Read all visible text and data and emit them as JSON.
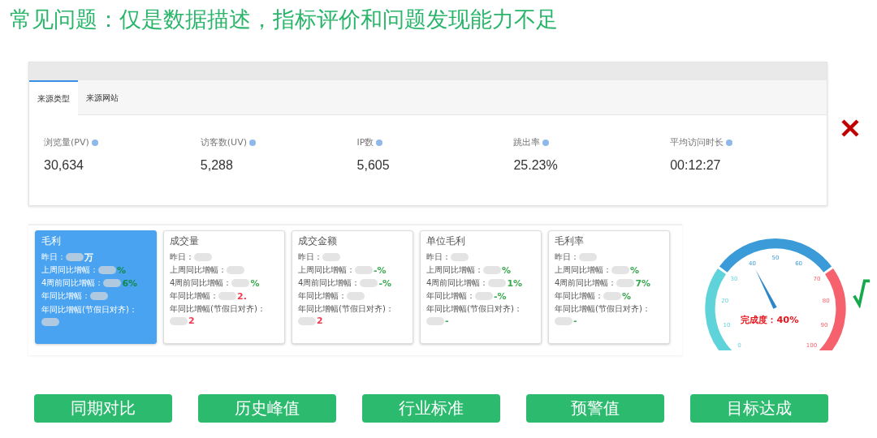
{
  "title": "常见问题：仅是数据描述，指标评价和问题发现能力不足",
  "traffic_panel": {
    "tabs": [
      {
        "label": "来源类型",
        "selected": true
      },
      {
        "label": "来源网站",
        "selected": false
      }
    ],
    "metrics": [
      {
        "label": "浏览量(PV)",
        "value": "30,634"
      },
      {
        "label": "访客数(UV)",
        "value": "5,288"
      },
      {
        "label": "IP数",
        "value": "5,605"
      },
      {
        "label": "跳出率",
        "value": "25.23%"
      },
      {
        "label": "平均访问时长",
        "value": "00:12:27"
      }
    ]
  },
  "kpi_panel": {
    "cards": [
      {
        "title": "毛利",
        "selected": true,
        "rows": [
          {
            "label": "昨日：",
            "value": "万",
            "color": "#ffffff"
          },
          {
            "label": "上周同比增幅：",
            "value": "%",
            "color": "#0f8a4a"
          },
          {
            "label": "4周前同比增幅：",
            "value": "6%",
            "color": "#0f8a4a"
          },
          {
            "label": "年同比增幅："
          },
          {
            "label": "年同比增幅(节假日对齐)："
          }
        ]
      },
      {
        "title": "成交量",
        "selected": false,
        "rows": [
          {
            "label": "昨日："
          },
          {
            "label": "上周同比增幅："
          },
          {
            "label": "4周前同比增幅：",
            "value": "%",
            "color": "#3aaa50"
          },
          {
            "label": "年同比增幅：",
            "value": "2.",
            "color": "#f03a50"
          },
          {
            "label": "年同比增幅(节假日对齐)：",
            "value": "2",
            "color": "#f03a50"
          }
        ]
      },
      {
        "title": "成交金额",
        "selected": false,
        "rows": [
          {
            "label": "昨日："
          },
          {
            "label": "上周同比增幅：",
            "value": "-%",
            "color": "#3aaa50"
          },
          {
            "label": "4周前同比增幅：",
            "value": "-%",
            "color": "#3aaa50"
          },
          {
            "label": "年同比增幅："
          },
          {
            "label": "年同比增幅(节假日对齐)：",
            "value": "2",
            "color": "#f03a50"
          }
        ]
      },
      {
        "title": "单位毛利",
        "selected": false,
        "rows": [
          {
            "label": "昨日："
          },
          {
            "label": "上周同比增幅：",
            "value": "%",
            "color": "#3aaa50"
          },
          {
            "label": "4周前同比增幅：",
            "value": "1%",
            "color": "#3aaa50"
          },
          {
            "label": "年同比增幅：",
            "value": "-%",
            "color": "#3aaa50"
          },
          {
            "label": "年同比增幅(节假日对齐)：",
            "value": "-",
            "color": "#3aaa50"
          }
        ]
      },
      {
        "title": "毛利率",
        "selected": false,
        "rows": [
          {
            "label": "昨日："
          },
          {
            "label": "上周同比增幅：",
            "value": "%",
            "color": "#3aaa50"
          },
          {
            "label": "4周前同比增幅：",
            "value": "7%",
            "color": "#3aaa50"
          },
          {
            "label": "年同比增幅：",
            "value": "%",
            "color": "#3aaa50"
          },
          {
            "label": "年同比增幅(节假日对齐)：",
            "value": "-",
            "color": "#3aaa50"
          }
        ]
      }
    ]
  },
  "gauge": {
    "level": 0.4,
    "ticks": [
      "0",
      "10",
      "20",
      "30",
      "40",
      "50",
      "60",
      "70",
      "80",
      "90",
      "100"
    ],
    "reading": "完成度：40%"
  },
  "buttons": [
    "同期对比",
    "历史峰值",
    "行业标准",
    "预警值",
    "目标达成"
  ]
}
